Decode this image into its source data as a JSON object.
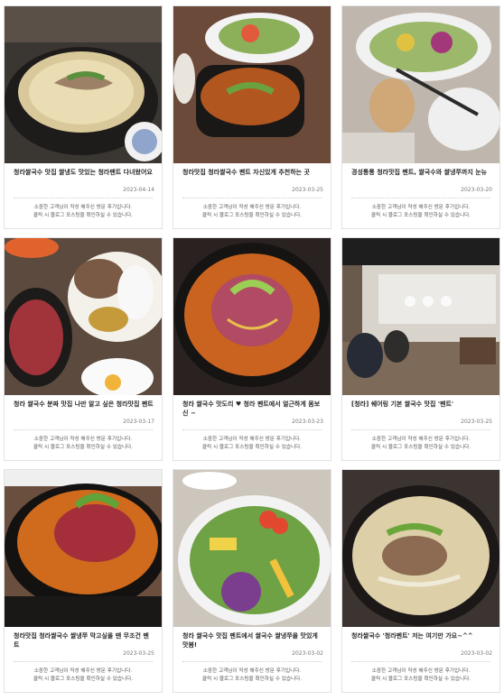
{
  "reviews": [
    {
      "title": "청라쌀국수 맛집 쌀냉도 맛있는 청라팬트 다녀왔어요",
      "date": "2023-04-14",
      "note1": "소중한 고객님이 작성 해주신 방문 후기입니다.",
      "note2": "클릭 시 블로그 포스팅을 확인하실 수 있습니다."
    },
    {
      "title": "청라맛집 청라쌀국수 펜트 자신있게 추천하는 곳",
      "date": "2023-03-25",
      "note1": "소중한 고객님이 작성 해주신 방문 후기입니다.",
      "note2": "클릭 시 블로그 포스팅을 확인하실 수 있습니다."
    },
    {
      "title": "경성통통 청라맛집 펜트, 쌀국수와 쌀냉쭈까지 눈뉴",
      "date": "2023-03-20",
      "note1": "소중한 고객님이 작성 해주신 방문 후기입니다.",
      "note2": "클릭 시 블로그 포스팅을 확인하실 수 있습니다."
    },
    {
      "title": "청라 쌀국수 분짜 맛집 나만 알고 싶은 청라맛집 펜트",
      "date": "2023-03-17",
      "note1": "소중한 고객님이 작성 해주신 방문 후기입니다.",
      "note2": "클릭 시 블로그 포스팅을 확인하실 수 있습니다."
    },
    {
      "title": "청라 쌀국수 맛도리 ♥ 청라 펜트에서 얼근하게 몸보신 ~",
      "date": "2023-03-23",
      "note1": "소중한 고객님이 작성 해주신 방문 후기입니다.",
      "note2": "클릭 시 블로그 포스팅을 확인하실 수 있습니다."
    },
    {
      "title": "[청라] 쉐어링 기본 쌀국수 맛집 '펜트'",
      "date": "2023-03-25",
      "note1": "소중한 고객님이 작성 해주신 방문 후기입니다.",
      "note2": "클릭 시 블로그 포스팅을 확인하실 수 있습니다."
    },
    {
      "title": "청라맛집 청라쌀국수 쌀냉쭈 막고싶을 땐 무조건 펜트",
      "date": "2023-03-25",
      "note1": "소중한 고객님이 작성 해주신 방문 후기입니다.",
      "note2": "클릭 시 블로그 포스팅을 확인하실 수 있습니다."
    },
    {
      "title": "청라 쌀국수 맛집 펜트에서 쌀국수 쌀냉쭈을 맛있게 맛봄!",
      "date": "2023-03-02",
      "note1": "소중한 고객님이 작성 해주신 방문 후기입니다.",
      "note2": "클릭 시 블로그 포스팅을 확인하실 수 있습니다."
    },
    {
      "title": "청라쌀국수 '청라펜트' 저는 여기만 가요~^^",
      "date": "2023-03-02",
      "note1": "소중한 고객님이 작성 해주신 방문 후기입니다.",
      "note2": "클릭 시 블로그 포스팅을 확인하실 수 있습니다."
    }
  ]
}
